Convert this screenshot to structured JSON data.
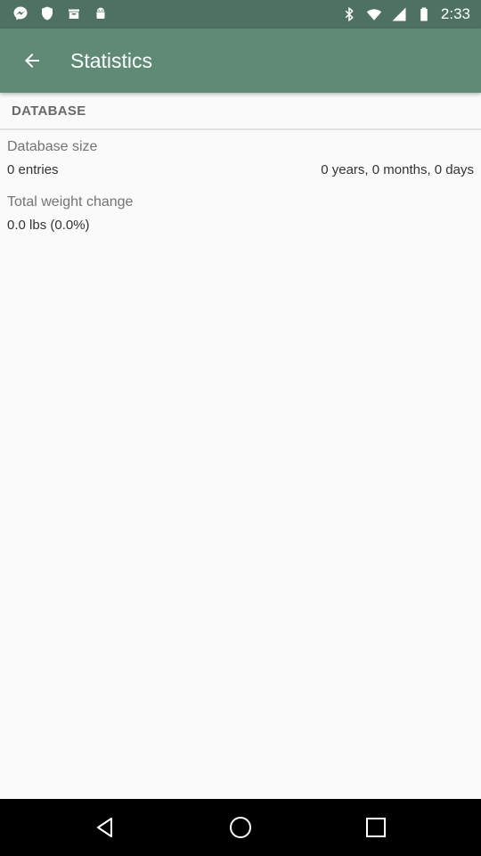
{
  "status_bar": {
    "time": "2:33",
    "left_icons": [
      "messenger-icon",
      "shield-icon",
      "box-icon",
      "android-icon"
    ],
    "right_icons": [
      "bluetooth-icon",
      "wifi-icon",
      "signal-icon",
      "battery-icon"
    ]
  },
  "app_bar": {
    "title": "Statistics",
    "back_icon": "arrow-back-icon"
  },
  "section": {
    "header": "DATABASE"
  },
  "stats": {
    "database_size_label": "Database size",
    "entries_value": "0 entries",
    "duration_value": "0 years, 0 months, 0 days",
    "weight_change_label": "Total weight change",
    "weight_change_value": "0.0 lbs (0.0%)"
  },
  "nav_bar": {
    "buttons": [
      "back-triangle-icon",
      "home-circle-icon",
      "recents-square-icon"
    ]
  },
  "colors": {
    "status_bar": "#4d7262",
    "app_bar": "#5e8a76",
    "background": "#fafafa",
    "nav_bar": "#000000"
  }
}
